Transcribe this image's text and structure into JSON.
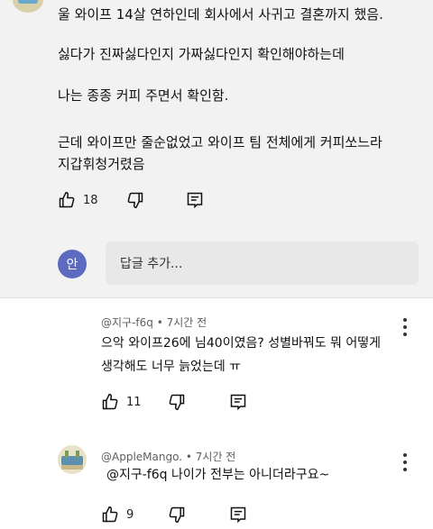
{
  "parent_comment": {
    "lines": [
      "울 와이프 14살 연하인데 회사에서 사귀고 결혼까지 했음.",
      "싫다가 진짜싫다인지 가짜싫다인지 확인해야하는데",
      "나는 종종 커피 주면서 확인함.",
      "근데 와이프만 줄순없었고 와이프 팀 전체에게 커피쏘느라",
      "지갑휘청거렸음"
    ],
    "like_count": "18"
  },
  "reply_input": {
    "avatar_letter": "안",
    "placeholder": "답글 추가..."
  },
  "replies": [
    {
      "author": "@지구-f6q",
      "time": "• 7시간 전",
      "lines": [
        "으악 와이프26에 님40이였음? 성별바꿔도 뭐 어떻게",
        "생각해도 너무 늙었는데 ㅠ"
      ],
      "like_count": "11"
    },
    {
      "author": "@AppleMango.",
      "time": "• 7시간 전",
      "mention": "@지구-f6q",
      "text": "나이가 전부는 아니더라구요~",
      "like_count": "9"
    }
  ]
}
